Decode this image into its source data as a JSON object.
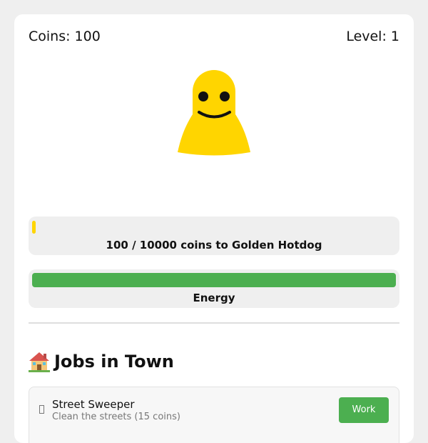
{
  "stats": {
    "coins": "Coins: 100",
    "level": "Level: 1"
  },
  "character": {
    "icon": "smiley-character",
    "color": "#FFD500"
  },
  "goal": {
    "label": "100 / 10000 coins to Golden Hotdog",
    "progress_fraction": 0.01,
    "color": "#FFD500"
  },
  "energy": {
    "label": "Energy",
    "level_fraction": 1.0,
    "color": "#4CAF50"
  },
  "jobs_section": {
    "icon": "house-icon",
    "title": "Jobs in Town"
  },
  "jobs": [
    {
      "icon": "broom-icon",
      "name": "Street Sweeper",
      "description": "Clean the streets (15 coins)",
      "button_label": "Work",
      "button_color": "#4CAF50"
    }
  ]
}
